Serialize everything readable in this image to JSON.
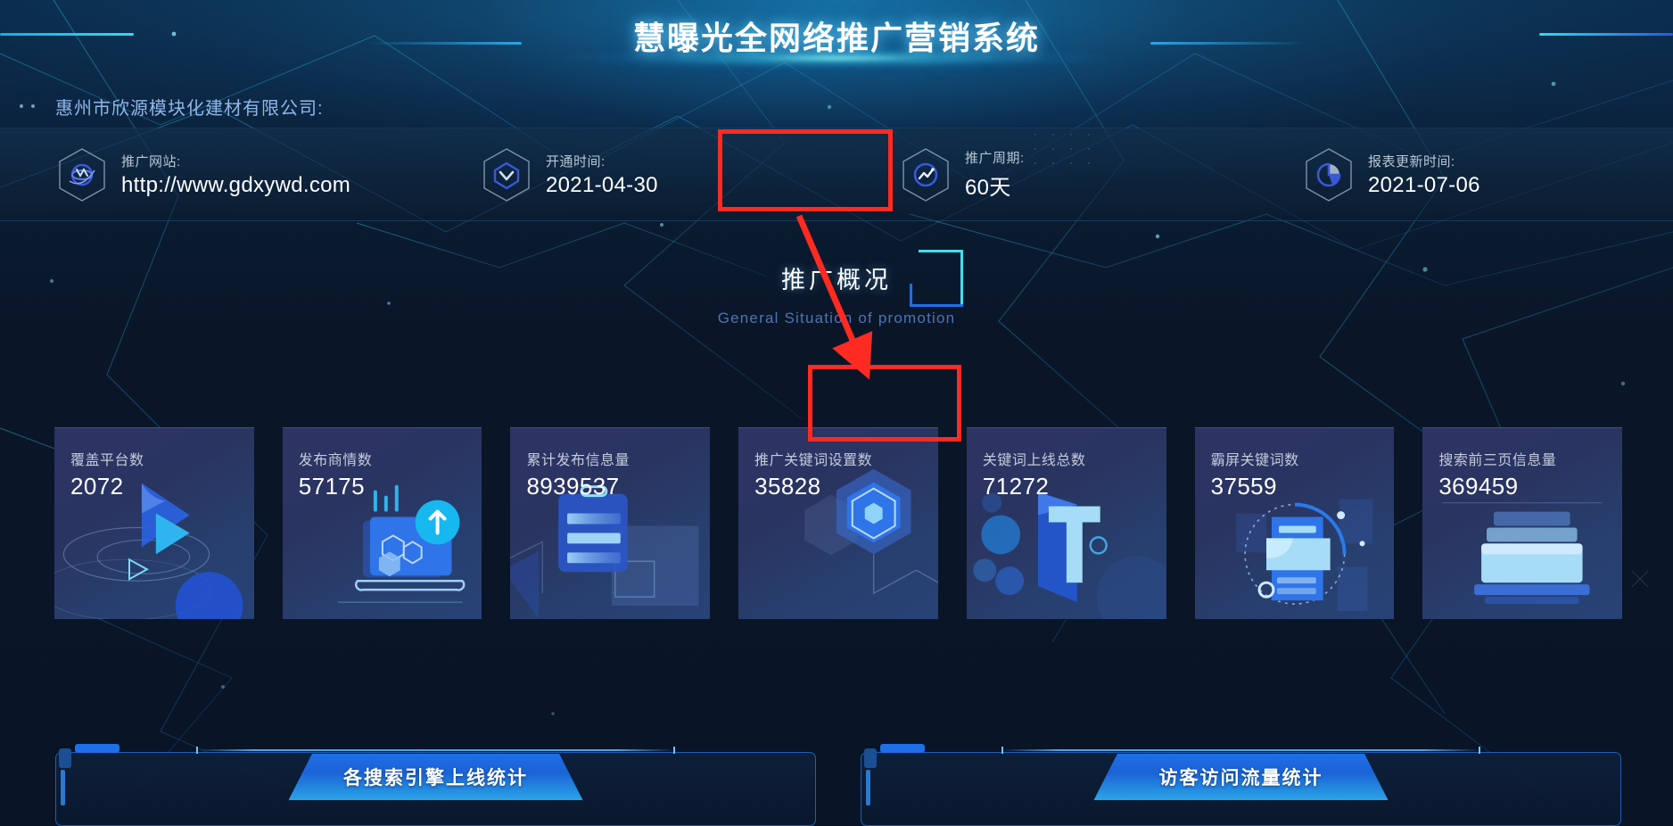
{
  "header": {
    "title": "慧曝光全网络推广营销系统",
    "company": "惠州市欣源模块化建材有限公司:"
  },
  "info_bar": {
    "items": [
      {
        "label": "推广网站:",
        "value": "http://www.gdxywd.com",
        "icon": "globe-hex-icon"
      },
      {
        "label": "开通时间:",
        "value": "2021-04-30",
        "icon": "check-chevron-hex-icon"
      },
      {
        "label": "推广周期:",
        "value": "60天",
        "icon": "trend-hex-icon"
      },
      {
        "label": "报表更新时间:",
        "value": "2021-07-06",
        "icon": "pie-hex-icon"
      }
    ]
  },
  "section": {
    "title": "推广概况",
    "subtitle": "General Situation of promotion"
  },
  "cards": [
    {
      "label": "覆盖平台数",
      "value": "2072",
      "icon": "play-orbit-icon"
    },
    {
      "label": "发布商情数",
      "value": "57175",
      "icon": "laptop-upload-icon"
    },
    {
      "label": "累计发布信息量",
      "value": "8939537",
      "icon": "clipboard-list-icon"
    },
    {
      "label": "推广关键词设置数",
      "value": "35828",
      "icon": "hexagon-cube-icon"
    },
    {
      "label": "关键词上线总数",
      "value": "71272",
      "icon": "letter-t-icon"
    },
    {
      "label": "霸屏关键词数",
      "value": "37559",
      "icon": "card-orbit-icon"
    },
    {
      "label": "搜索前三页信息量",
      "value": "369459",
      "icon": "stacked-pages-icon"
    }
  ],
  "panels": [
    {
      "tab": "各搜索引擎上线统计"
    },
    {
      "tab": "访客访问流量统计"
    }
  ],
  "highlights": {
    "color": "#ff2a22",
    "boxes": [
      "推广周期: 60天",
      "关键词上线总数: 71272"
    ],
    "arrow": "annotation-arrow"
  },
  "colors": {
    "accent_cyan": "#3fe0f0",
    "accent_blue": "#1f6fe8",
    "bg_dark": "#091427",
    "card_bg": "#2a3461",
    "highlight_red": "#ff2a22"
  }
}
